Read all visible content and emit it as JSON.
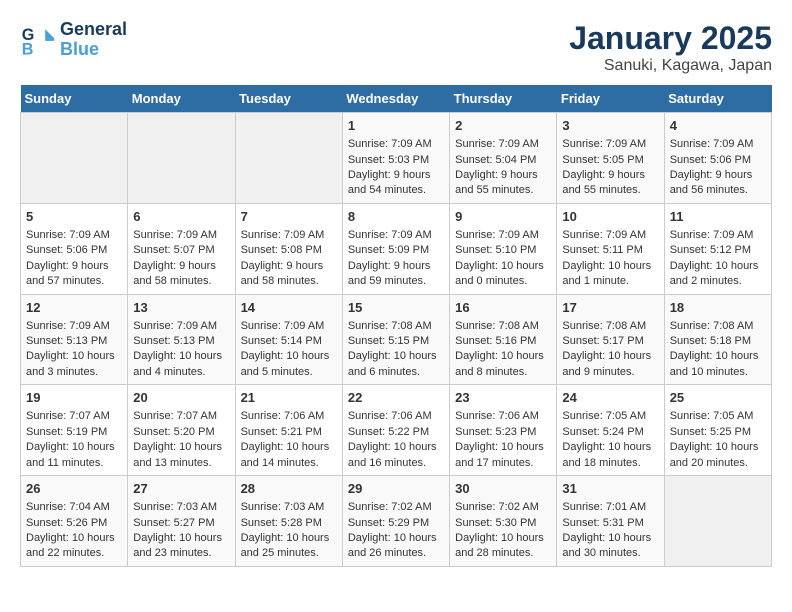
{
  "header": {
    "logo_line1": "General",
    "logo_line2": "Blue",
    "title": "January 2025",
    "subtitle": "Sanuki, Kagawa, Japan"
  },
  "weekdays": [
    "Sunday",
    "Monday",
    "Tuesday",
    "Wednesday",
    "Thursday",
    "Friday",
    "Saturday"
  ],
  "weeks": [
    [
      {
        "day": "",
        "content": ""
      },
      {
        "day": "",
        "content": ""
      },
      {
        "day": "",
        "content": ""
      },
      {
        "day": "1",
        "content": "Sunrise: 7:09 AM\nSunset: 5:03 PM\nDaylight: 9 hours\nand 54 minutes."
      },
      {
        "day": "2",
        "content": "Sunrise: 7:09 AM\nSunset: 5:04 PM\nDaylight: 9 hours\nand 55 minutes."
      },
      {
        "day": "3",
        "content": "Sunrise: 7:09 AM\nSunset: 5:05 PM\nDaylight: 9 hours\nand 55 minutes."
      },
      {
        "day": "4",
        "content": "Sunrise: 7:09 AM\nSunset: 5:06 PM\nDaylight: 9 hours\nand 56 minutes."
      }
    ],
    [
      {
        "day": "5",
        "content": "Sunrise: 7:09 AM\nSunset: 5:06 PM\nDaylight: 9 hours\nand 57 minutes."
      },
      {
        "day": "6",
        "content": "Sunrise: 7:09 AM\nSunset: 5:07 PM\nDaylight: 9 hours\nand 58 minutes."
      },
      {
        "day": "7",
        "content": "Sunrise: 7:09 AM\nSunset: 5:08 PM\nDaylight: 9 hours\nand 58 minutes."
      },
      {
        "day": "8",
        "content": "Sunrise: 7:09 AM\nSunset: 5:09 PM\nDaylight: 9 hours\nand 59 minutes."
      },
      {
        "day": "9",
        "content": "Sunrise: 7:09 AM\nSunset: 5:10 PM\nDaylight: 10 hours\nand 0 minutes."
      },
      {
        "day": "10",
        "content": "Sunrise: 7:09 AM\nSunset: 5:11 PM\nDaylight: 10 hours\nand 1 minute."
      },
      {
        "day": "11",
        "content": "Sunrise: 7:09 AM\nSunset: 5:12 PM\nDaylight: 10 hours\nand 2 minutes."
      }
    ],
    [
      {
        "day": "12",
        "content": "Sunrise: 7:09 AM\nSunset: 5:13 PM\nDaylight: 10 hours\nand 3 minutes."
      },
      {
        "day": "13",
        "content": "Sunrise: 7:09 AM\nSunset: 5:13 PM\nDaylight: 10 hours\nand 4 minutes."
      },
      {
        "day": "14",
        "content": "Sunrise: 7:09 AM\nSunset: 5:14 PM\nDaylight: 10 hours\nand 5 minutes."
      },
      {
        "day": "15",
        "content": "Sunrise: 7:08 AM\nSunset: 5:15 PM\nDaylight: 10 hours\nand 6 minutes."
      },
      {
        "day": "16",
        "content": "Sunrise: 7:08 AM\nSunset: 5:16 PM\nDaylight: 10 hours\nand 8 minutes."
      },
      {
        "day": "17",
        "content": "Sunrise: 7:08 AM\nSunset: 5:17 PM\nDaylight: 10 hours\nand 9 minutes."
      },
      {
        "day": "18",
        "content": "Sunrise: 7:08 AM\nSunset: 5:18 PM\nDaylight: 10 hours\nand 10 minutes."
      }
    ],
    [
      {
        "day": "19",
        "content": "Sunrise: 7:07 AM\nSunset: 5:19 PM\nDaylight: 10 hours\nand 11 minutes."
      },
      {
        "day": "20",
        "content": "Sunrise: 7:07 AM\nSunset: 5:20 PM\nDaylight: 10 hours\nand 13 minutes."
      },
      {
        "day": "21",
        "content": "Sunrise: 7:06 AM\nSunset: 5:21 PM\nDaylight: 10 hours\nand 14 minutes."
      },
      {
        "day": "22",
        "content": "Sunrise: 7:06 AM\nSunset: 5:22 PM\nDaylight: 10 hours\nand 16 minutes."
      },
      {
        "day": "23",
        "content": "Sunrise: 7:06 AM\nSunset: 5:23 PM\nDaylight: 10 hours\nand 17 minutes."
      },
      {
        "day": "24",
        "content": "Sunrise: 7:05 AM\nSunset: 5:24 PM\nDaylight: 10 hours\nand 18 minutes."
      },
      {
        "day": "25",
        "content": "Sunrise: 7:05 AM\nSunset: 5:25 PM\nDaylight: 10 hours\nand 20 minutes."
      }
    ],
    [
      {
        "day": "26",
        "content": "Sunrise: 7:04 AM\nSunset: 5:26 PM\nDaylight: 10 hours\nand 22 minutes."
      },
      {
        "day": "27",
        "content": "Sunrise: 7:03 AM\nSunset: 5:27 PM\nDaylight: 10 hours\nand 23 minutes."
      },
      {
        "day": "28",
        "content": "Sunrise: 7:03 AM\nSunset: 5:28 PM\nDaylight: 10 hours\nand 25 minutes."
      },
      {
        "day": "29",
        "content": "Sunrise: 7:02 AM\nSunset: 5:29 PM\nDaylight: 10 hours\nand 26 minutes."
      },
      {
        "day": "30",
        "content": "Sunrise: 7:02 AM\nSunset: 5:30 PM\nDaylight: 10 hours\nand 28 minutes."
      },
      {
        "day": "31",
        "content": "Sunrise: 7:01 AM\nSunset: 5:31 PM\nDaylight: 10 hours\nand 30 minutes."
      },
      {
        "day": "",
        "content": ""
      }
    ]
  ]
}
